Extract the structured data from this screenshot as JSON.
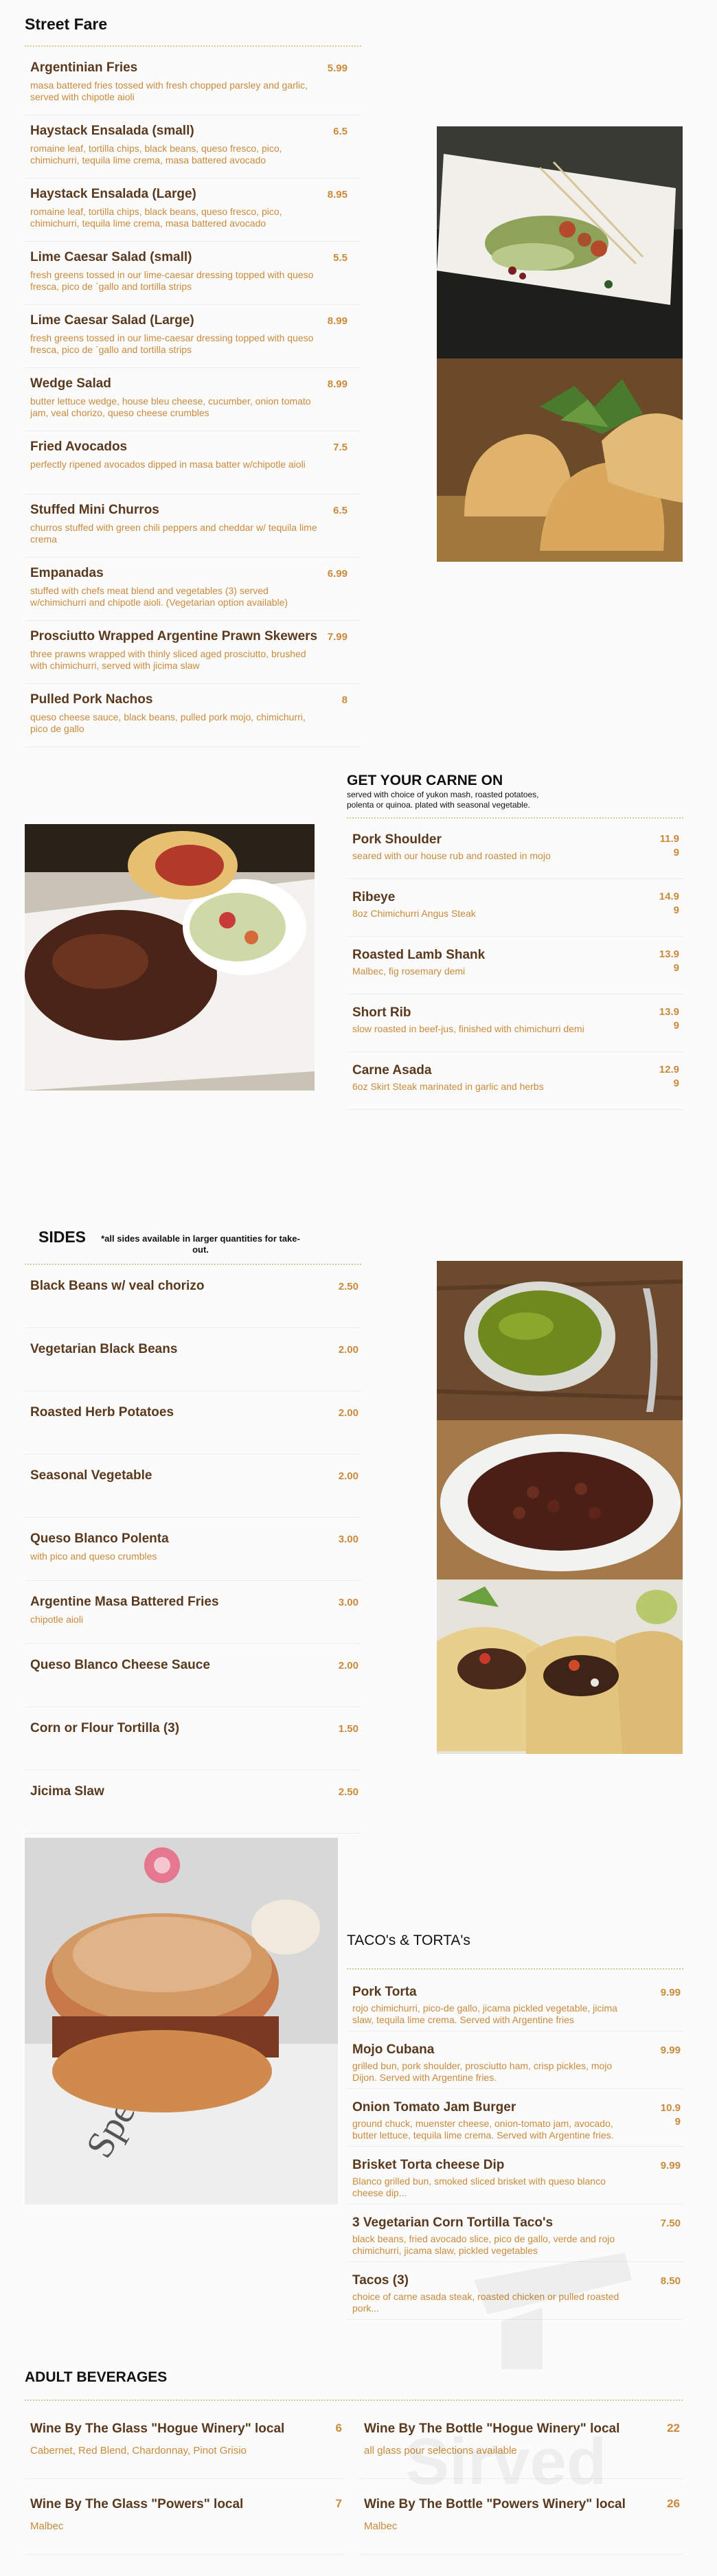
{
  "street_fare": {
    "title": "Street Fare",
    "items": [
      {
        "name": "Argentinian Fries",
        "price": "5.99",
        "desc": "masa battered fries tossed with fresh chopped parsley and garlic, served with chipotle aioli"
      },
      {
        "name": "Haystack Ensalada (small)",
        "price": "6.5",
        "desc": "romaine leaf, tortilla chips, black beans, queso fresco, pico, chimichurri, tequila lime crema, masa battered avocado"
      },
      {
        "name": "Haystack Ensalada (Large)",
        "price": "8.95",
        "desc": "romaine leaf, tortilla chips, black beans, queso fresco, pico, chimichurri, tequila lime crema, masa battered avocado"
      },
      {
        "name": "Lime Caesar Salad (small)",
        "price": "5.5",
        "desc": "fresh greens tossed in our lime-caesar dressing topped with queso fresca, pico de `gallo and tortilla strips"
      },
      {
        "name": "Lime Caesar Salad (Large)",
        "price": "8.99",
        "desc": "fresh greens tossed in our lime-caesar dressing topped with queso fresca, pico de `gallo and tortilla strips"
      },
      {
        "name": "Wedge Salad",
        "price": "8.99",
        "desc": "butter lettuce wedge, house bleu cheese, cucumber, onion tomato jam, veal chorizo, queso cheese crumbles"
      },
      {
        "name": "Fried Avocados",
        "price": "7.5",
        "desc": "perfectly ripened avocados dipped in masa batter w/chipotle aioli"
      },
      {
        "name": "Stuffed Mini Churros",
        "price": "6.5",
        "desc": "churros stuffed with green chili peppers and cheddar w/ tequila lime crema"
      },
      {
        "name": "Empanadas",
        "price": "6.99",
        "desc": "stuffed with chefs meat blend and vegetables (3) served w/chimichurri and chipotle aioli. (Vegetarian option available)"
      },
      {
        "name": "Prosciutto Wrapped Argentine Prawn Skewers",
        "price": "7.99",
        "desc": "three prawns wrapped with thinly sliced aged prosciutto, brushed with chimichurri, served with jicima slaw"
      },
      {
        "name": "Pulled Pork Nachos",
        "price": "8",
        "desc": "queso cheese sauce, black beans, pulled pork mojo, chimichurri, pico de gallo"
      }
    ]
  },
  "carne": {
    "title": "GET YOUR CARNE ON",
    "subtitle": "served with choice of yukon mash, roasted potatoes, polenta or quinoa. plated with seasonal vegetable.",
    "items": [
      {
        "name": "Pork Shoulder",
        "price": "11.99",
        "desc": "seared with our house rub and roasted in mojo"
      },
      {
        "name": "Ribeye",
        "price": "14.99",
        "desc": "8oz Chimichurri Angus Steak"
      },
      {
        "name": "Roasted Lamb Shank",
        "price": "13.99",
        "desc": "Malbec, fig rosemary demi"
      },
      {
        "name": "Short Rib",
        "price": "13.99",
        "desc": "slow roasted in beef-jus, finished with chimichurri demi"
      },
      {
        "name": "Carne Asada",
        "price": "12.99",
        "desc": "6oz Skirt Steak marinated in garlic and herbs"
      }
    ]
  },
  "sides": {
    "title": "SIDES",
    "note": "*all sides available in larger quantities for take-out.",
    "items": [
      {
        "name": "Black Beans w/ veal chorizo",
        "price": "2.50",
        "desc": ""
      },
      {
        "name": "Vegetarian Black Beans",
        "price": "2.00",
        "desc": ""
      },
      {
        "name": "Roasted Herb Potatoes",
        "price": "2.00",
        "desc": ""
      },
      {
        "name": "Seasonal Vegetable",
        "price": "2.00",
        "desc": ""
      },
      {
        "name": "Queso Blanco Polenta",
        "price": "3.00",
        "desc": "with pico and queso crumbles"
      },
      {
        "name": "Argentine Masa Battered Fries",
        "price": "3.00",
        "desc": "chipotle aioli"
      },
      {
        "name": "Queso Blanco Cheese Sauce",
        "price": "2.00",
        "desc": ""
      },
      {
        "name": "Corn or Flour Tortilla  (3)",
        "price": "1.50",
        "desc": ""
      },
      {
        "name": "Jicima Slaw",
        "price": "2.50",
        "desc": ""
      }
    ]
  },
  "tacos": {
    "title": "TACO's & TORTA's",
    "items": [
      {
        "name": "Pork Torta",
        "price": "9.99",
        "desc": "rojo chimichurri, pico-de gallo, jicama pickled vegetable, jicima slaw, tequila lime crema. Served with Argentine fries"
      },
      {
        "name": "Mojo Cubana",
        "price": "9.99",
        "desc": "grilled bun, pork shoulder, prosciutto ham, crisp pickles, mojo Dijon. Served with Argentine fries."
      },
      {
        "name": "Onion Tomato Jam Burger",
        "price": "10.99",
        "desc": "ground chuck, muenster cheese, onion-tomato jam, avocado, butter lettuce, tequila lime crema. Served with Argentine fries."
      },
      {
        "name": "Brisket Torta cheese Dip",
        "price": "9.99",
        "desc": "Blanco grilled bun, smoked sliced brisket with queso blanco cheese dip..."
      },
      {
        "name": "3 Vegetarian Corn Tortilla Taco's",
        "price": "7.50",
        "desc": "black beans, fried avocado slice, pico de gallo, verde and rojo chimichurri, jicama slaw, pickled vegetables"
      },
      {
        "name": "Tacos (3)",
        "price": "8.50",
        "desc": "choice of carne asada steak, roasted chicken or pulled roasted pork..."
      }
    ]
  },
  "beverages": {
    "title": "ADULT BEVERAGES",
    "items": [
      {
        "name": "Wine By The Glass  \"Hogue Winery\" local",
        "price": "6",
        "desc": "Cabernet, Red Blend, Chardonnay, Pinot Grisio"
      },
      {
        "name": "Wine By The Bottle   \"Hogue Winery\" local",
        "price": "22",
        "desc": "all glass pour selections available"
      },
      {
        "name": "Wine By The Glass   \"Powers\" local",
        "price": "7",
        "desc": "Malbec"
      },
      {
        "name": "Wine By The Bottle \"Powers Winery\" local",
        "price": "26",
        "desc": "Malbec"
      }
    ]
  },
  "watermark": {
    "text": "Sirved"
  },
  "colors": {
    "accent": "#c98a3c",
    "item_name": "#5a3a1e",
    "divider": "#d9c79a"
  }
}
